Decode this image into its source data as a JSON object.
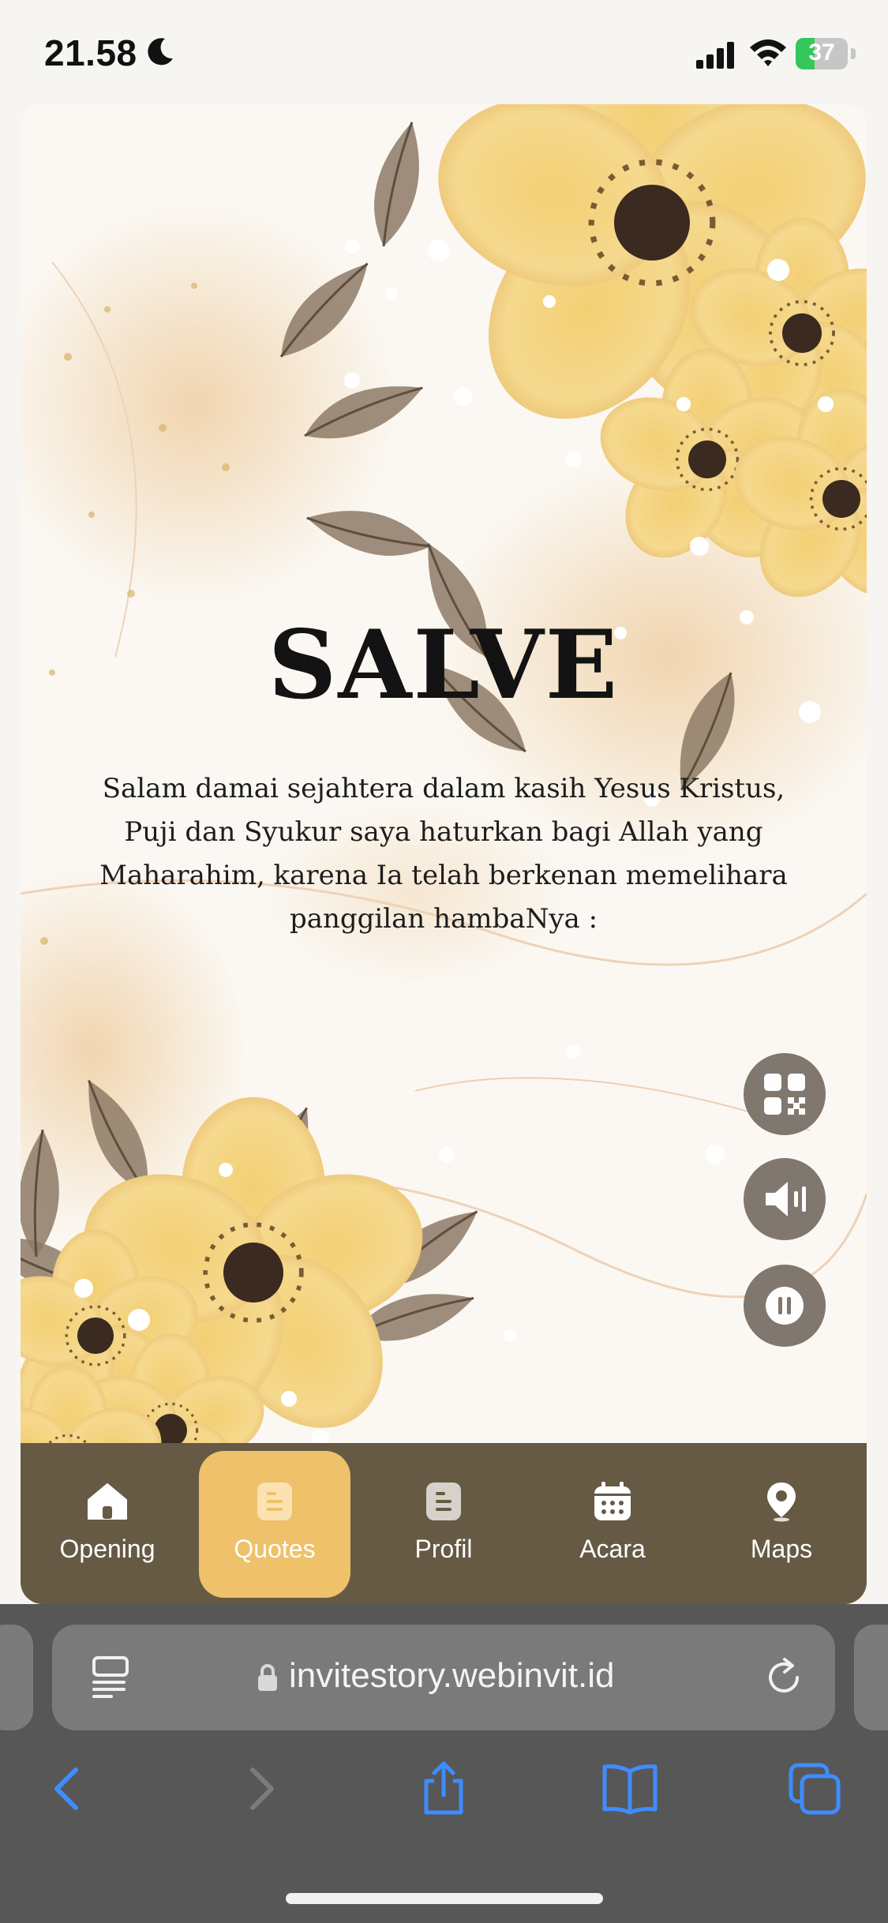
{
  "status_bar": {
    "time": "21.58",
    "battery_level": "37",
    "battery_fraction": 0.37,
    "moon_icon": "moon-icon",
    "signal_icon": "cellular-signal-icon",
    "wifi_icon": "wifi-icon"
  },
  "invitation": {
    "title": "SALVE",
    "message": "Salam damai sejahtera dalam kasih Yesus Kristus, Puji dan Syukur saya haturkan bagi Allah yang Maharahim, karena Ia telah berkenan memelihara panggilan hambaNya :"
  },
  "floating_buttons": [
    {
      "icon": "qr-code-icon"
    },
    {
      "icon": "speaker-icon"
    },
    {
      "icon": "pause-icon"
    }
  ],
  "bottom_nav": {
    "active_index": 1,
    "items": [
      {
        "label": "Opening",
        "icon": "home-icon"
      },
      {
        "label": "Quotes",
        "icon": "document-icon"
      },
      {
        "label": "Profil",
        "icon": "document-icon"
      },
      {
        "label": "Acara",
        "icon": "calendar-icon"
      },
      {
        "label": "Maps",
        "icon": "map-pin-icon"
      }
    ]
  },
  "browser": {
    "url": "invitestory.webinvit.id"
  },
  "colors": {
    "nav_background": "#665a44",
    "nav_active": "#eec16a",
    "fab_background": "#7a7167",
    "browser_accent": "#3f8cff",
    "battery_green": "#34c759"
  }
}
